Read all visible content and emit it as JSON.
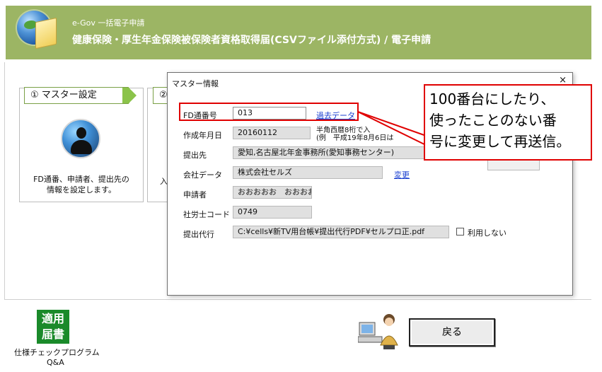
{
  "header": {
    "app_title": "e-Gov 一括電子申請",
    "form_title": "健康保険・厚生年金保険被保険者資格取得届(CSVファイル添付方式) / 電子申請"
  },
  "steps": [
    {
      "label": "① マスター設定",
      "desc_line1": "FD通番、申請者、提出先の",
      "desc_line2": "情報を設定します。"
    },
    {
      "label": "②",
      "stub": "入"
    }
  ],
  "dialog": {
    "title": "マスター情報",
    "close": "×",
    "rows": {
      "fd_number": {
        "label": "FD通番号",
        "value": "013",
        "link": "過去データ"
      },
      "created": {
        "label": "作成年月日",
        "value": "20160112",
        "hint1": "半角西暦8桁で入",
        "hint2": "(例　平成19年8月6日は"
      },
      "submit_to": {
        "label": "提出先",
        "value": "愛知,名古屋北年金事務所(愛知事務センター)"
      },
      "company": {
        "label": "会社データ",
        "value": "株式会社セルズ",
        "link": "変更"
      },
      "applicant": {
        "label": "申請者",
        "value": "おおおおお　おおおお"
      },
      "sharoushi": {
        "label": "社労士コード",
        "value": "0749"
      },
      "proxy": {
        "label": "提出代行",
        "value": "C:¥cells¥新TV用台帳¥提出代行PDF¥セルプロ正.pdf",
        "checkbox_label": "利用しない"
      }
    }
  },
  "callout": {
    "line1": "100番台にしたり、",
    "line2": "使ったことのない番",
    "line3": "号に変更して再送信。"
  },
  "bottom": {
    "app_icon_line1": "適用",
    "app_icon_line2": "届書",
    "app_caption1": "仕様チェックプログラム",
    "app_caption2": "Q&A",
    "back_button": "戻る"
  },
  "colors": {
    "header_bg": "#9cb564",
    "annotation_red": "#e00000",
    "link_blue": "#1a3fd0"
  }
}
